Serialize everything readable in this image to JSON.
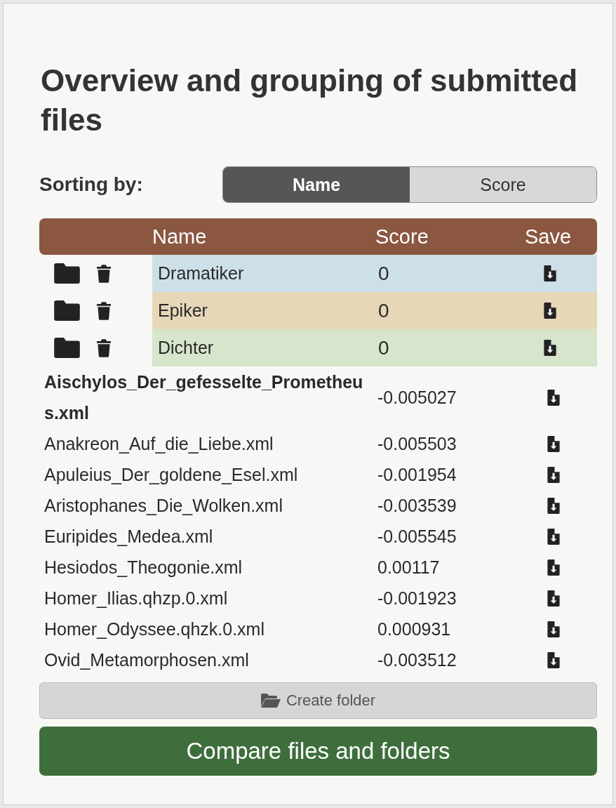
{
  "title": "Overview and grouping of submitted files",
  "sorting": {
    "label": "Sorting by:",
    "options": [
      {
        "label": "Name",
        "selected": true
      },
      {
        "label": "Score",
        "selected": false
      }
    ]
  },
  "table": {
    "columns": [
      "Name",
      "Score",
      "Save"
    ],
    "folders": [
      {
        "name": "Dramatiker",
        "score": "0",
        "color": "#cde0e8"
      },
      {
        "name": "Epiker",
        "score": "0",
        "color": "#e6d7b8"
      },
      {
        "name": "Dichter",
        "score": "0",
        "color": "#d6e5cb"
      }
    ],
    "files": [
      {
        "name": "Aischylos_Der_gefesselte_Prometheus.xml",
        "score": "-0.005027",
        "selected": true
      },
      {
        "name": "Anakreon_Auf_die_Liebe.xml",
        "score": "-0.005503",
        "selected": false
      },
      {
        "name": "Apuleius_Der_goldene_Esel.xml",
        "score": "-0.001954",
        "selected": false
      },
      {
        "name": "Aristophanes_Die_Wolken.xml",
        "score": "-0.003539",
        "selected": false
      },
      {
        "name": "Euripides_Medea.xml",
        "score": "-0.005545",
        "selected": false
      },
      {
        "name": "Hesiodos_Theogonie.xml",
        "score": "0.00117",
        "selected": false
      },
      {
        "name": "Homer_Ilias.qhzp.0.xml",
        "score": "-0.001923",
        "selected": false
      },
      {
        "name": "Homer_Odyssee.qhzk.0.xml",
        "score": "0.000931",
        "selected": false
      },
      {
        "name": "Ovid_Metamorphosen.xml",
        "score": "-0.003512",
        "selected": false
      }
    ]
  },
  "create_button": "Create folder",
  "compare_button": "Compare files and folders"
}
